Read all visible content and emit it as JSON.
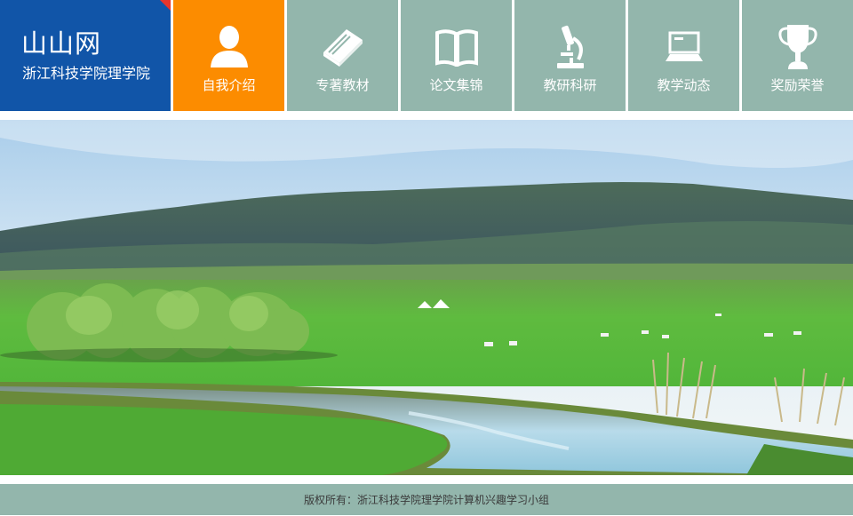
{
  "site": {
    "title": "山山网",
    "subtitle": "浙江科技学院理学院"
  },
  "nav": [
    {
      "label": "自我介绍",
      "icon": "user-icon",
      "active": true
    },
    {
      "label": "专著教材",
      "icon": "book-icon",
      "active": false
    },
    {
      "label": "论文集锦",
      "icon": "open-book-icon",
      "active": false
    },
    {
      "label": "教研科研",
      "icon": "microscope-icon",
      "active": false
    },
    {
      "label": "教学动态",
      "icon": "laptop-icon",
      "active": false
    },
    {
      "label": "奖励荣誉",
      "icon": "trophy-icon",
      "active": false
    }
  ],
  "footer": {
    "text": "版权所有：浙江科技学院理学院计算机兴趣学习小组"
  },
  "colors": {
    "logo_bg": "#1155a8",
    "nav_bg": "#93b6ac",
    "nav_active_bg": "#fc8c00",
    "footer_bg": "#93b6ac"
  }
}
